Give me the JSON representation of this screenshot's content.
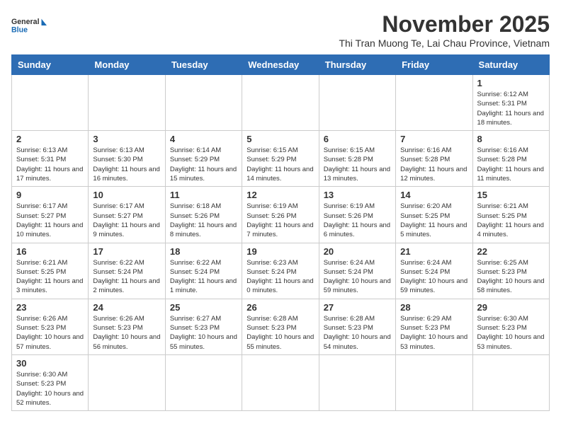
{
  "header": {
    "logo_general": "General",
    "logo_blue": "Blue",
    "month_title": "November 2025",
    "location": "Thi Tran Muong Te, Lai Chau Province, Vietnam"
  },
  "weekdays": [
    "Sunday",
    "Monday",
    "Tuesday",
    "Wednesday",
    "Thursday",
    "Friday",
    "Saturday"
  ],
  "days": [
    {
      "number": "",
      "info": ""
    },
    {
      "number": "",
      "info": ""
    },
    {
      "number": "",
      "info": ""
    },
    {
      "number": "",
      "info": ""
    },
    {
      "number": "",
      "info": ""
    },
    {
      "number": "",
      "info": ""
    },
    {
      "number": "1",
      "info": "Sunrise: 6:12 AM\nSunset: 5:31 PM\nDaylight: 11 hours and 18 minutes."
    },
    {
      "number": "2",
      "info": "Sunrise: 6:13 AM\nSunset: 5:31 PM\nDaylight: 11 hours and 17 minutes."
    },
    {
      "number": "3",
      "info": "Sunrise: 6:13 AM\nSunset: 5:30 PM\nDaylight: 11 hours and 16 minutes."
    },
    {
      "number": "4",
      "info": "Sunrise: 6:14 AM\nSunset: 5:29 PM\nDaylight: 11 hours and 15 minutes."
    },
    {
      "number": "5",
      "info": "Sunrise: 6:15 AM\nSunset: 5:29 PM\nDaylight: 11 hours and 14 minutes."
    },
    {
      "number": "6",
      "info": "Sunrise: 6:15 AM\nSunset: 5:28 PM\nDaylight: 11 hours and 13 minutes."
    },
    {
      "number": "7",
      "info": "Sunrise: 6:16 AM\nSunset: 5:28 PM\nDaylight: 11 hours and 12 minutes."
    },
    {
      "number": "8",
      "info": "Sunrise: 6:16 AM\nSunset: 5:28 PM\nDaylight: 11 hours and 11 minutes."
    },
    {
      "number": "9",
      "info": "Sunrise: 6:17 AM\nSunset: 5:27 PM\nDaylight: 11 hours and 10 minutes."
    },
    {
      "number": "10",
      "info": "Sunrise: 6:17 AM\nSunset: 5:27 PM\nDaylight: 11 hours and 9 minutes."
    },
    {
      "number": "11",
      "info": "Sunrise: 6:18 AM\nSunset: 5:26 PM\nDaylight: 11 hours and 8 minutes."
    },
    {
      "number": "12",
      "info": "Sunrise: 6:19 AM\nSunset: 5:26 PM\nDaylight: 11 hours and 7 minutes."
    },
    {
      "number": "13",
      "info": "Sunrise: 6:19 AM\nSunset: 5:26 PM\nDaylight: 11 hours and 6 minutes."
    },
    {
      "number": "14",
      "info": "Sunrise: 6:20 AM\nSunset: 5:25 PM\nDaylight: 11 hours and 5 minutes."
    },
    {
      "number": "15",
      "info": "Sunrise: 6:21 AM\nSunset: 5:25 PM\nDaylight: 11 hours and 4 minutes."
    },
    {
      "number": "16",
      "info": "Sunrise: 6:21 AM\nSunset: 5:25 PM\nDaylight: 11 hours and 3 minutes."
    },
    {
      "number": "17",
      "info": "Sunrise: 6:22 AM\nSunset: 5:24 PM\nDaylight: 11 hours and 2 minutes."
    },
    {
      "number": "18",
      "info": "Sunrise: 6:22 AM\nSunset: 5:24 PM\nDaylight: 11 hours and 1 minute."
    },
    {
      "number": "19",
      "info": "Sunrise: 6:23 AM\nSunset: 5:24 PM\nDaylight: 11 hours and 0 minutes."
    },
    {
      "number": "20",
      "info": "Sunrise: 6:24 AM\nSunset: 5:24 PM\nDaylight: 10 hours and 59 minutes."
    },
    {
      "number": "21",
      "info": "Sunrise: 6:24 AM\nSunset: 5:24 PM\nDaylight: 10 hours and 59 minutes."
    },
    {
      "number": "22",
      "info": "Sunrise: 6:25 AM\nSunset: 5:23 PM\nDaylight: 10 hours and 58 minutes."
    },
    {
      "number": "23",
      "info": "Sunrise: 6:26 AM\nSunset: 5:23 PM\nDaylight: 10 hours and 57 minutes."
    },
    {
      "number": "24",
      "info": "Sunrise: 6:26 AM\nSunset: 5:23 PM\nDaylight: 10 hours and 56 minutes."
    },
    {
      "number": "25",
      "info": "Sunrise: 6:27 AM\nSunset: 5:23 PM\nDaylight: 10 hours and 55 minutes."
    },
    {
      "number": "26",
      "info": "Sunrise: 6:28 AM\nSunset: 5:23 PM\nDaylight: 10 hours and 55 minutes."
    },
    {
      "number": "27",
      "info": "Sunrise: 6:28 AM\nSunset: 5:23 PM\nDaylight: 10 hours and 54 minutes."
    },
    {
      "number": "28",
      "info": "Sunrise: 6:29 AM\nSunset: 5:23 PM\nDaylight: 10 hours and 53 minutes."
    },
    {
      "number": "29",
      "info": "Sunrise: 6:30 AM\nSunset: 5:23 PM\nDaylight: 10 hours and 53 minutes."
    },
    {
      "number": "30",
      "info": "Sunrise: 6:30 AM\nSunset: 5:23 PM\nDaylight: 10 hours and 52 minutes."
    },
    {
      "number": "",
      "info": ""
    },
    {
      "number": "",
      "info": ""
    },
    {
      "number": "",
      "info": ""
    },
    {
      "number": "",
      "info": ""
    },
    {
      "number": "",
      "info": ""
    },
    {
      "number": "",
      "info": ""
    },
    {
      "number": "",
      "info": ""
    }
  ]
}
